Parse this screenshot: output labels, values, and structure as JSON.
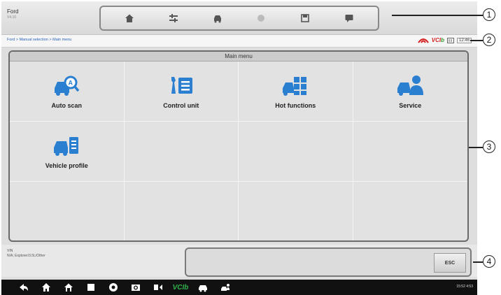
{
  "header": {
    "make": "Ford",
    "version": "V4.10"
  },
  "toolbar": {
    "buttons": [
      {
        "icon": "home-icon"
      },
      {
        "icon": "vehicle-swap-icon"
      },
      {
        "icon": "car-front-icon"
      },
      {
        "icon": "screenshot-icon"
      },
      {
        "icon": "save-icon"
      },
      {
        "icon": "datalogging-icon"
      }
    ]
  },
  "breadcrumb": "Ford > Manual selection > Main menu",
  "status": {
    "vcb_label": "VCI",
    "vcb_suffix": "b",
    "time": "12:46"
  },
  "main": {
    "title": "Main menu",
    "items": [
      {
        "label": "Auto scan",
        "icon": "auto-scan-icon"
      },
      {
        "label": "Control unit",
        "icon": "control-unit-icon"
      },
      {
        "label": "Hot functions",
        "icon": "hot-functions-icon"
      },
      {
        "label": "Service",
        "icon": "service-icon"
      },
      {
        "label": "Vehicle profile",
        "icon": "vehicle-profile-icon"
      }
    ]
  },
  "info": {
    "line1": "VIN",
    "line2": "N/A; Explorer/3.5L/Other"
  },
  "esc_label": "ESC",
  "navbar": {
    "vci_label": "VCI",
    "vci_suffix": "b",
    "system_status": "15:52 4:53"
  },
  "callouts": [
    "1",
    "2",
    "3",
    "4"
  ],
  "colors": {
    "accent_blue": "#2b7fd0",
    "vci_green": "#36a030",
    "vci_red": "#d32020"
  }
}
